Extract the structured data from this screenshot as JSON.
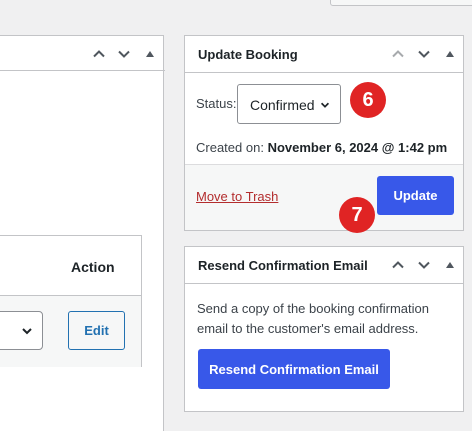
{
  "left_panel": {
    "action_header": "Action",
    "edit_label": "Edit"
  },
  "update_booking": {
    "title": "Update Booking",
    "status_label": "Status:",
    "status_value": "Confirmed",
    "created_label": "Created on:",
    "created_value": "November 6, 2024 @ 1:42 pm",
    "trash_label": "Move to Trash",
    "update_label": "Update",
    "badge_status": "6",
    "badge_update": "7"
  },
  "resend": {
    "title": "Resend Confirmation Email",
    "description_line1": "Send a copy of the booking confirmation",
    "description_line2": "email to the customer's email address.",
    "button_label": "Resend Confirmation Email"
  },
  "colors": {
    "primary": "#3858e9",
    "badge": "#e02424",
    "trash_link": "#b32d2e",
    "border": "#c3c4c7",
    "background": "#f0f0f1"
  },
  "icons": [
    "chevron-up-icon",
    "chevron-down-icon",
    "triangle-up-icon"
  ]
}
